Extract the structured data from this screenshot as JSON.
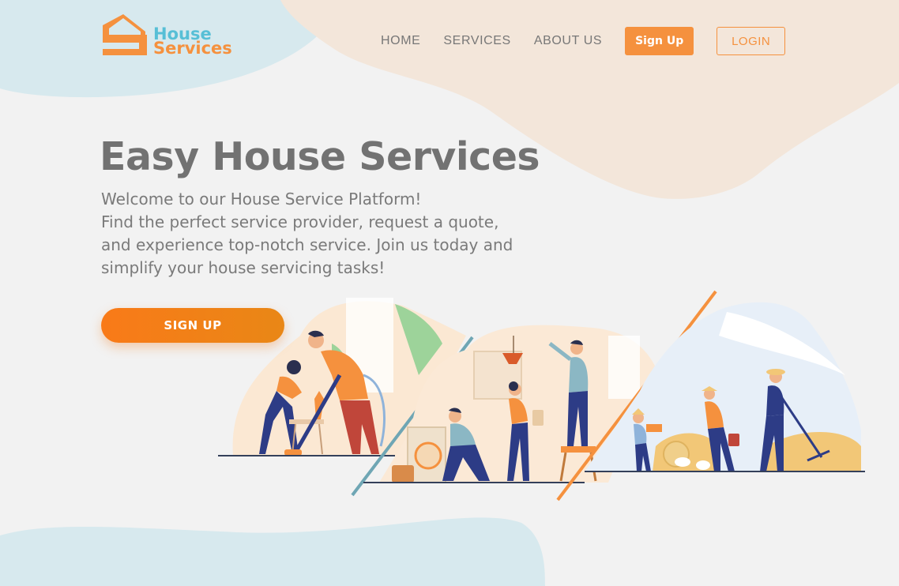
{
  "brand": {
    "word1": "House",
    "word2": "Services",
    "colors": {
      "orange": "#f5913e",
      "teal": "#57bfd6"
    }
  },
  "nav": {
    "links": [
      "HOME",
      "SERVICES",
      "ABOUT US"
    ],
    "signup_label": "Sign Up",
    "login_label": "LOGIN"
  },
  "hero": {
    "title": "Easy House Services",
    "description_lines": [
      "Welcome to our House Service Platform!",
      "Find the perfect service provider, request a quote,",
      "and experience top-notch service. Join us today and",
      "simplify your house servicing tasks!"
    ],
    "cta_label": "SIGN UP"
  },
  "illustration": {
    "icon": "house-services-workers-illustration"
  },
  "colors": {
    "background": "#f2f2f2",
    "blob_teal": "#d6e9ee",
    "blob_peach": "#f3e7dc",
    "accent": "#f5913e",
    "title_text": "#727272"
  }
}
